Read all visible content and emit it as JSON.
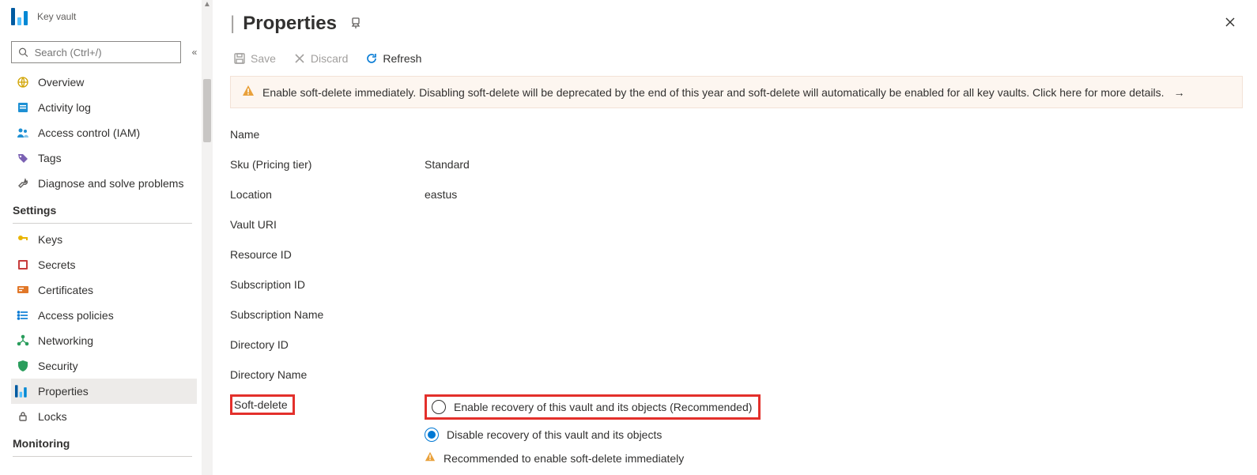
{
  "resourceType": "Key vault",
  "header": {
    "title": "Properties"
  },
  "search": {
    "placeholder": "Search (Ctrl+/)"
  },
  "sidebar": {
    "top": [
      {
        "label": "Overview"
      },
      {
        "label": "Activity log"
      },
      {
        "label": "Access control (IAM)"
      },
      {
        "label": "Tags"
      },
      {
        "label": "Diagnose and solve problems"
      }
    ],
    "sectionSettings": "Settings",
    "settings": [
      {
        "label": "Keys"
      },
      {
        "label": "Secrets"
      },
      {
        "label": "Certificates"
      },
      {
        "label": "Access policies"
      },
      {
        "label": "Networking"
      },
      {
        "label": "Security"
      },
      {
        "label": "Properties"
      },
      {
        "label": "Locks"
      }
    ],
    "sectionMonitoring": "Monitoring"
  },
  "toolbar": {
    "save": "Save",
    "discard": "Discard",
    "refresh": "Refresh"
  },
  "banner": {
    "text": "Enable soft-delete immediately. Disabling soft-delete will be deprecated by the end of this year and soft-delete will automatically be enabled for all key vaults. Click here for more details."
  },
  "properties": {
    "name": {
      "label": "Name",
      "value": ""
    },
    "sku": {
      "label": "Sku (Pricing tier)",
      "value": "Standard"
    },
    "location": {
      "label": "Location",
      "value": "eastus"
    },
    "vaultUri": {
      "label": "Vault URI",
      "value": ""
    },
    "resourceId": {
      "label": "Resource ID",
      "value": ""
    },
    "subscriptionId": {
      "label": "Subscription ID",
      "value": ""
    },
    "subscriptionName": {
      "label": "Subscription Name",
      "value": ""
    },
    "directoryId": {
      "label": "Directory ID",
      "value": ""
    },
    "directoryName": {
      "label": "Directory Name",
      "value": ""
    },
    "softDelete": {
      "label": "Soft-delete",
      "optionEnable": "Enable recovery of this vault and its objects (Recommended)",
      "optionDisable": "Disable recovery of this vault and its objects",
      "recommendation": "Recommended to enable soft-delete immediately"
    }
  }
}
